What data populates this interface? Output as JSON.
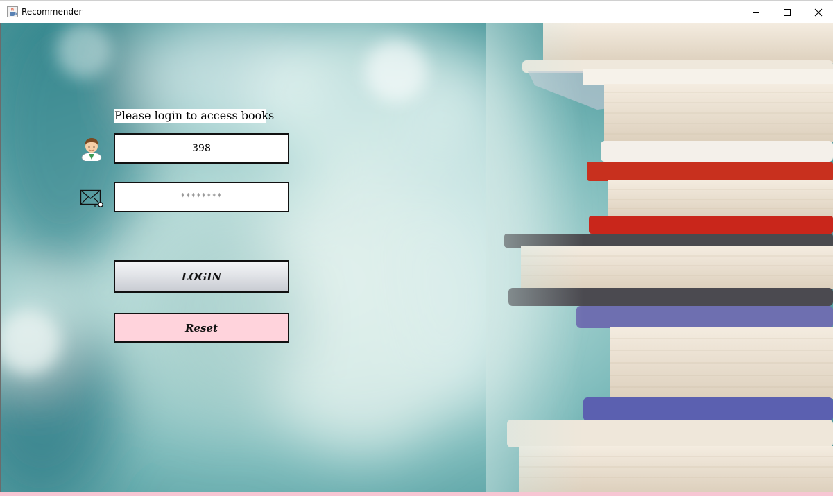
{
  "window": {
    "title": "Recommender"
  },
  "login": {
    "prompt": "Please login to access books",
    "username_value": "398",
    "password_value": "********",
    "login_label": "LOGIN",
    "reset_label": "Reset"
  },
  "icons": {
    "app": "java-cup-icon",
    "user": "user-avatar-icon",
    "password": "mail-key-icon",
    "minimize": "minimize-icon",
    "maximize": "maximize-icon",
    "close": "close-icon"
  },
  "colors": {
    "reset_button": "#ffd3dc",
    "login_button": "#e2e4e8",
    "background_teal": "#4e9a9d",
    "bottom_strip": "#f7c6d3"
  }
}
